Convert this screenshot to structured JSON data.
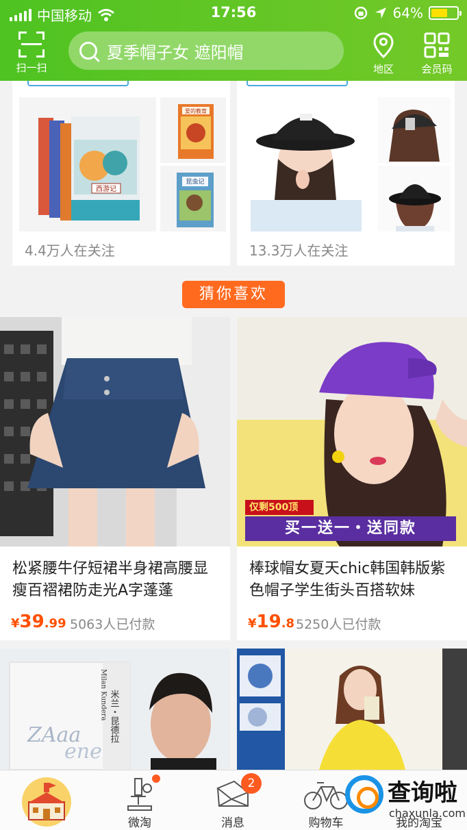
{
  "status_bar": {
    "carrier": "中国移动",
    "time": "17:56",
    "battery_percent": "64%",
    "battery_level": 0.64
  },
  "header": {
    "scan_label": "扫一扫",
    "search_text": "夏季帽子女 遮阳帽",
    "region_label": "地区",
    "member_code_label": "会员码"
  },
  "top_cards": [
    {
      "followers": "4.4万人在关注"
    },
    {
      "followers": "13.3万人在关注"
    }
  ],
  "book_covers": [
    "西游记",
    "爱的教育",
    "昆虫记"
  ],
  "guess_section": {
    "title": "猜你喜欢"
  },
  "products": [
    {
      "title": "松紧腰牛仔短裙半身裙高腰显瘦百褶裙防走光A字蓬蓬",
      "currency": "¥",
      "price_int": "39",
      "price_dec": ".99",
      "sold": "5063人已付款"
    },
    {
      "title": "棒球帽女夏天chic韩国韩版紫色帽子学生街头百搭软妹",
      "currency": "¥",
      "price_int": "19",
      "price_dec": ".8",
      "sold": "5250人已付款",
      "promo_tag": "仅剩500顶",
      "promo_text": "买一送一・送同款"
    },
    {
      "cover_title": "米兰・昆德拉",
      "cover_en": "Milan Kundera"
    },
    {}
  ],
  "tab_bar": {
    "tabs": [
      {
        "label": ""
      },
      {
        "label": "微淘"
      },
      {
        "label": "消息",
        "badge": "2"
      },
      {
        "label": "购物车"
      },
      {
        "label": "我的淘宝"
      }
    ]
  },
  "watermark": {
    "title": "查询啦",
    "domain": "chaxunla.com"
  },
  "colors": {
    "header_green": "#4ec322",
    "accent_orange": "#ff5000",
    "guess_orange": "#ff6a1f",
    "promo_purple": "#5a2ea0"
  }
}
